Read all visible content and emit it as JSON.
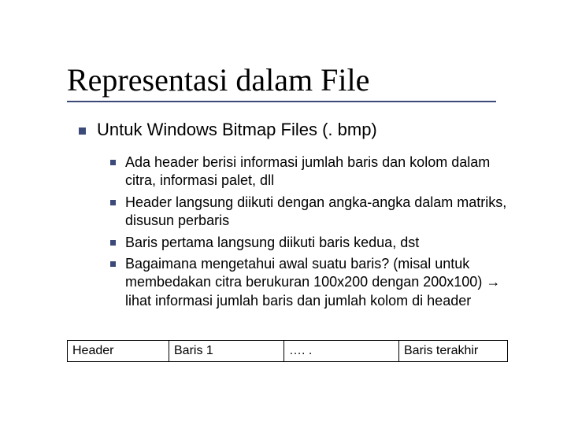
{
  "title": "Representasi dalam File",
  "level1": "Untuk Windows Bitmap Files (. bmp)",
  "sub": [
    "Ada header berisi informasi jumlah baris dan kolom dalam citra, informasi palet, dll",
    "Header langsung diikuti dengan angka-angka dalam matriks, disusun perbaris",
    "Baris pertama langsung diikuti baris kedua, dst",
    "Bagaimana mengetahui awal suatu baris? (misal untuk membedakan citra berukuran 100x200 dengan 200x100) → lihat informasi jumlah baris dan jumlah kolom di header"
  ],
  "table": {
    "cells": [
      "Header",
      "Baris 1",
      "…. .",
      "Baris terakhir"
    ]
  }
}
